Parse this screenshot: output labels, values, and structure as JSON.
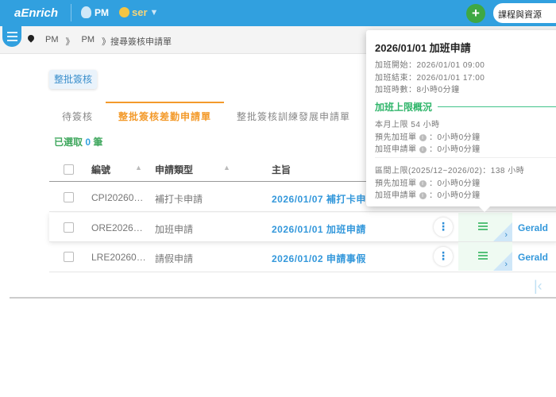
{
  "header": {
    "logo": "aEnrich",
    "role": "PM",
    "user": "ser",
    "add_label": "+",
    "resources": "課程與資源"
  },
  "breadcrumb": [
    "PM",
    "》",
    "PM",
    "》搜尋簽核申請單"
  ],
  "batch_button": "整批簽核",
  "tabs": [
    {
      "label": "待簽核"
    },
    {
      "label": "整批簽核差勤申請單"
    },
    {
      "label": "整批簽核訓練發展申請單"
    }
  ],
  "selected": {
    "prefix": "已選取",
    "count": "0",
    "suffix": "筆"
  },
  "columns": {
    "id": "編號",
    "type": "申請類型",
    "subject": "主旨"
  },
  "rows": [
    {
      "id": "CPI20260…",
      "type": "補打卡申請",
      "subject": "2026/01/07 補打卡申",
      "name": ""
    },
    {
      "id": "ORE2026…",
      "type": "加班申請",
      "subject": "2026/01/01 加班申請",
      "name": "Gerald"
    },
    {
      "id": "LRE20260…",
      "type": "請假申請",
      "subject": "2026/01/02 申請事假",
      "name": "Gerald"
    }
  ],
  "popup": {
    "title": "2026/01/01 加班申請",
    "start": "加班開始：2026/01/01 09:00",
    "end": "加班結束：2026/01/01 17:00",
    "hours": "加班時數：8小時0分鐘",
    "section": "加班上限概況",
    "month_limit": "本月上限 54 小時",
    "pre_label": "預先加班單",
    "app_label": "加班申請單",
    "month_pre": "：0小時0分鐘",
    "month_app": "：0小時0分鐘",
    "range_limit": "區間上限(2025/12~2026/02)：138 小時",
    "range_pre": "：0小時0分鐘",
    "range_app": "：0小時0分鐘"
  }
}
